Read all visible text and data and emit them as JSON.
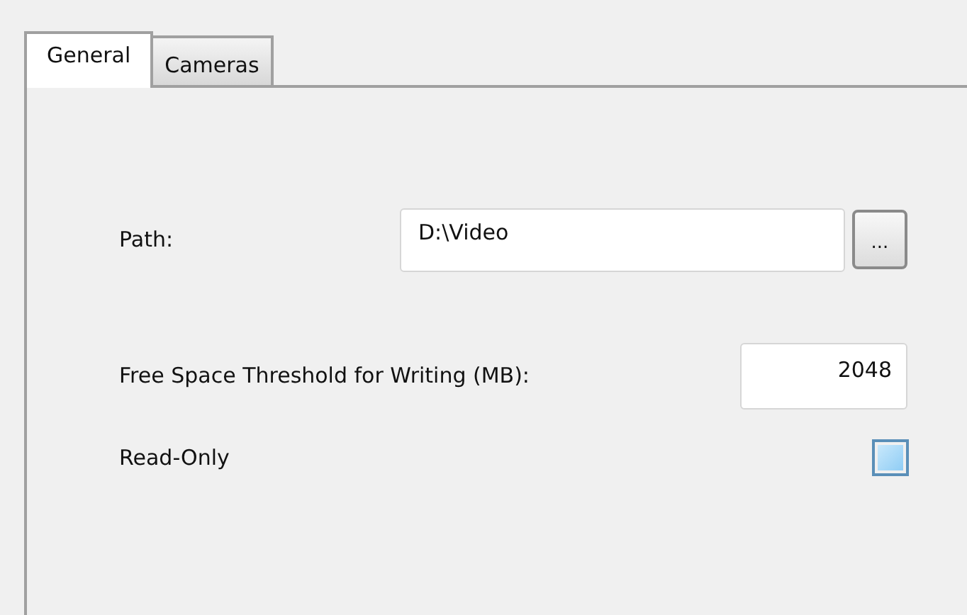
{
  "tabs": [
    {
      "label": "General",
      "selected": true
    },
    {
      "label": "Cameras",
      "selected": false
    }
  ],
  "path": {
    "label": "Path:",
    "value": "D:\\Video",
    "browse_button": "..."
  },
  "free_space": {
    "label": "Free Space Threshold for Writing (MB):",
    "value": "2048"
  },
  "read_only": {
    "label": "Read-Only",
    "checked": false
  }
}
